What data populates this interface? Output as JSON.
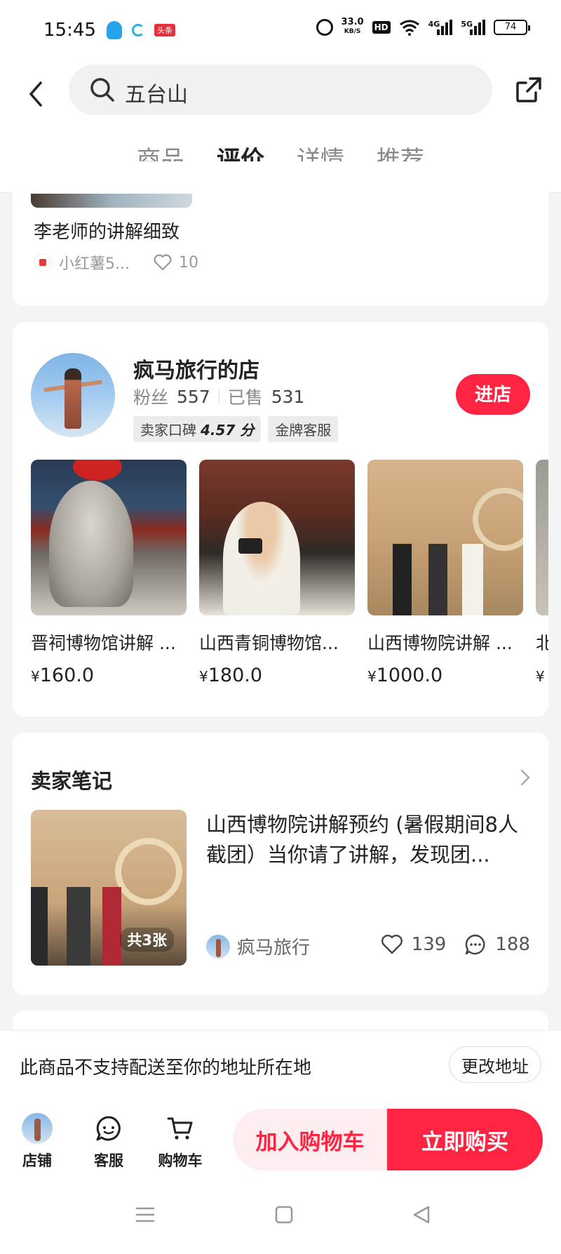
{
  "status_bar": {
    "time": "15:45",
    "app_badge": "头条",
    "net_speed_value": "33.0",
    "net_speed_unit": "KB/S",
    "hd_label": "HD",
    "signal1_label": "4G",
    "signal2_label": "5G",
    "battery": "74"
  },
  "header": {
    "search_query": "五台山",
    "tabs": [
      {
        "label": "商品",
        "active": false
      },
      {
        "label": "评价",
        "active": true
      },
      {
        "label": "详情",
        "active": false
      },
      {
        "label": "推荐",
        "active": false
      }
    ]
  },
  "review": {
    "text": "李老师的讲解细致",
    "author": "小红薯5...",
    "likes": "10"
  },
  "shop": {
    "name": "疯马旅行的店",
    "fans_label": "粉丝",
    "fans": "557",
    "sold_label": "已售",
    "sold": "531",
    "rating_label": "卖家口碑",
    "rating": "4.57 分",
    "service_badge": "金牌客服",
    "enter_label": "进店",
    "products": [
      {
        "name": "晋祠博物馆讲解 ...",
        "price": "160.0"
      },
      {
        "name": "山西青铜博物馆...",
        "price": "180.0"
      },
      {
        "name": "山西博物院讲解 ...",
        "price": "1000.0"
      },
      {
        "name": "北",
        "price": ""
      }
    ],
    "currency": "¥"
  },
  "seller_notes": {
    "title": "卖家笔记",
    "text": "山西博物院讲解预约 (暑假期间8人截团）当你请了讲解，发现团...",
    "image_count": "共3张",
    "author": "疯马旅行",
    "likes": "139",
    "comments": "188"
  },
  "delivery": {
    "message": "此商品不支持配送至你的地址所在地",
    "change_label": "更改地址"
  },
  "bottom_bar": {
    "shop_label": "店铺",
    "service_label": "客服",
    "cart_label": "购物车",
    "add_to_cart": "加入购物车",
    "buy_now": "立即购买"
  },
  "colors": {
    "accent": "#ff2442",
    "accent_light": "#ffeef0"
  }
}
